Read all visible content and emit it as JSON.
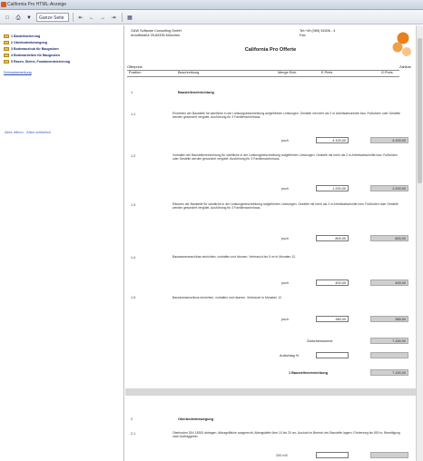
{
  "window": {
    "title": "California Pro HTML-Anzeige"
  },
  "toolbar": {
    "zoom_label": "Ganze Seite"
  },
  "sidebar": {
    "items": [
      {
        "label": "1 Bauteilsicherung"
      },
      {
        "label": "2 Oberbodenbewegung"
      },
      {
        "label": "3 Bodenaushub für Baugruben"
      },
      {
        "label": "4 Bodenarbeiten für Baugruben"
      },
      {
        "label": "5 Rasen, Steine, Fundamentsicherung"
      },
      {
        "label": "Schlussbemerkung"
      }
    ],
    "link": "Alles öffnen · Alles schließen"
  },
  "doc": {
    "company": "G&W Software Consulting GmbH",
    "address": "Arnulfstraße 25,80335 München",
    "tel": "Tel:+49 (089) 51506 - 4",
    "fax": "Fax:",
    "title": "California Pro Offerte",
    "hdr_left": "Offerpreis",
    "hdr_right": "Zahlbar",
    "col_pos": "Position",
    "col_desc": "Beschreibung",
    "col_qty": "Menge Einh.",
    "col_price": "E.Preis",
    "col_total": "G.Preis",
    "section1": {
      "nr": "1",
      "title": "Baustelleneinrichtung"
    },
    "positions": [
      {
        "nr": "1.1",
        "desc": "Einrichten der Baustelle für sämtliche in der Leistungsbeschreibung aufgeführten Leistungen. Gestelle mit mehr als 2 m Arbeitsabschnitte bzw. Fußböden oder Gestelle werden gesondert vergütet. Ausführung für 3 Familienwohnhaus.",
        "unit": "psch",
        "price": "4.100,00",
        "total": "4.100,00"
      },
      {
        "nr": "1.2",
        "desc": "Vorhalten der Baustelleneinrichtung für sämtliche in der Leistungsbeschreibung aufgeführten Leistungen. Gestelle mit mehr als 2 m Arbeitsabschnitte bzw. Fußböden oder Gestelle werden gesondert vergütet. Ausführung für 3 Familienwohnhaus.",
        "unit": "psch",
        "price": "1.200,00",
        "total": "1.200,00"
      },
      {
        "nr": "1.3",
        "desc": "Räumen der Baustelle für sämtliche in der Leistungsbeschreibung aufgeführten Leistungen. Gestelle mit mehr als 2 m Arbeitsabschnitte bzw. Fußböden oder Gestelle werden gesondert vergütet. Ausführung für 3 Familienwohnhaus.",
        "unit": "psch",
        "price": "800,00",
        "total": "800,00"
      },
      {
        "nr": "1.4",
        "desc": "Bauwasseranschluss einrichten, vorhalten und räumen. Verbrauch bis 5 m³ in Monaten 12.",
        "unit": "psch",
        "price": "400,00",
        "total": "400,00"
      },
      {
        "nr": "1.5",
        "desc": "Baustromanschluss einrichten, vorhalten und räumen. Verbrauch in Monaten 12.",
        "unit": "psch",
        "price": "380,00",
        "total": "380,00"
      }
    ],
    "zwischensumme_label": "Zwischensumme",
    "zwischensumme_value": "7.150,00",
    "aufschlag_label": "Aufschlag %",
    "aufschlag_value": "",
    "sum_label": "1 Baustelleneinrichtung",
    "sum_value": "7.150,00",
    "section2": {
      "nr": "2",
      "title": "Oberbodenbewegung"
    },
    "pos21": {
      "nr": "2.1",
      "desc": "Oberboden DIN 18300 abtragen, Abtragsfläche ausgerecht, Abtragstiefe über 10 bis 20 cm, Aushub im Bereich der Baustelle lagern, Förderweg bis 500 m, Beseitigung nach Auftraggeber.",
      "qty": "200 m3"
    }
  },
  "colors": {
    "accent": "#e8801e",
    "sidebar_text": "#1a2a6a",
    "grey_box": "#cfcfcf"
  }
}
